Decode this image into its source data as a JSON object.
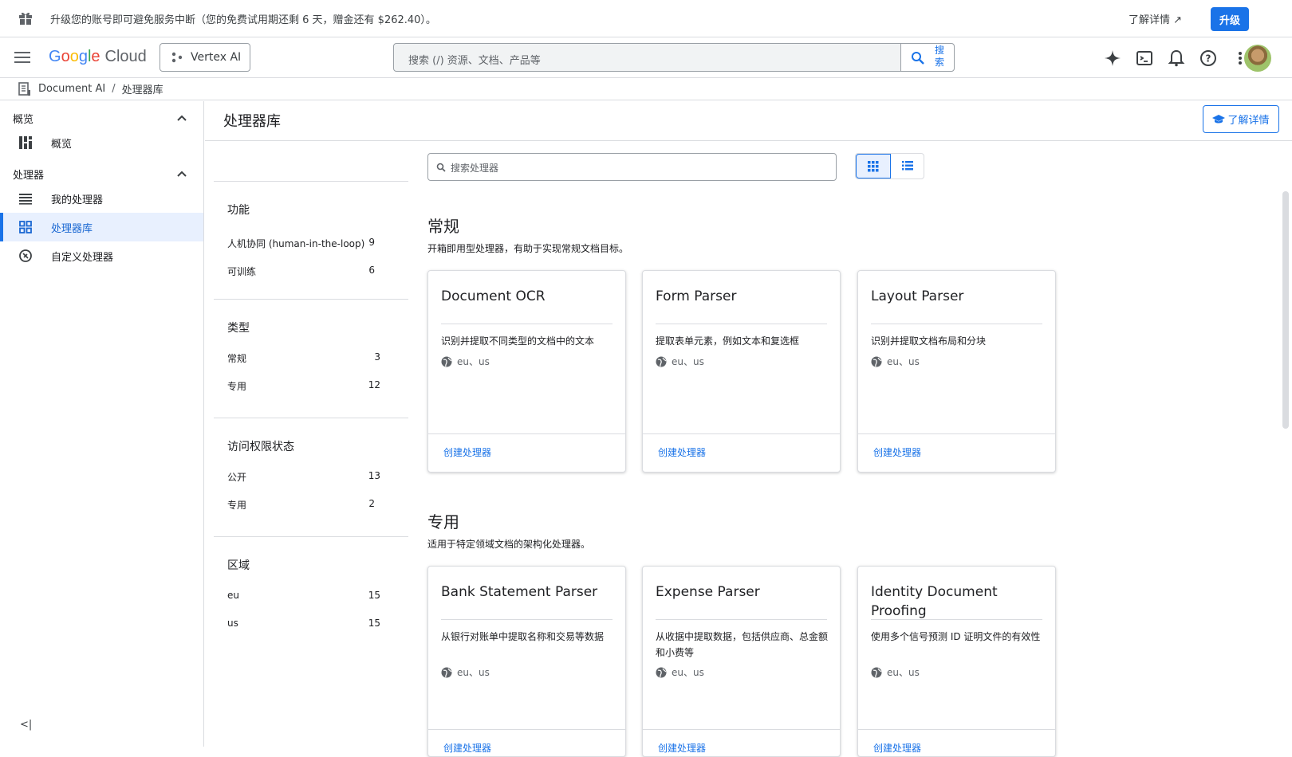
{
  "banner": {
    "message": "升级您的账号即可避免服务中断（您的免费试用期还剩 6 天，赠金还有 $262.40）。",
    "learn_more": "了解详情",
    "upgrade": "升级"
  },
  "header": {
    "logo_letters": [
      "G",
      "o",
      "o",
      "g",
      "l",
      "e"
    ],
    "logo_suffix": "Cloud",
    "product": "Vertex AI",
    "search_placeholder": "搜索 (/) 资源、文档、产品等",
    "search_button": "搜索"
  },
  "breadcrumb": {
    "root": "Document AI",
    "separator": "/",
    "current": "处理器库"
  },
  "sidebar": {
    "sections": [
      {
        "label": "概览",
        "items": [
          {
            "label": "概览",
            "icon": "dashboard-icon"
          }
        ]
      },
      {
        "label": "处理器",
        "items": [
          {
            "label": "我的处理器",
            "icon": "list-icon"
          },
          {
            "label": "处理器库",
            "icon": "grid-icon",
            "active": true
          },
          {
            "label": "自定义处理器",
            "icon": "custom-icon"
          }
        ]
      }
    ],
    "collapse": "<|"
  },
  "main": {
    "title": "处理器库",
    "learn_more": "了解详情",
    "search_placeholder": "搜索处理器"
  },
  "filters": [
    {
      "heading": "功能",
      "rows": [
        {
          "label": "人机协同 (human-in-the-loop)",
          "count": "9"
        },
        {
          "label": "可训练",
          "count": "6"
        }
      ]
    },
    {
      "heading": "类型",
      "rows": [
        {
          "label": "常规",
          "count": "3"
        },
        {
          "label": "专用",
          "count": "12"
        }
      ]
    },
    {
      "heading": "访问权限状态",
      "rows": [
        {
          "label": "公开",
          "count": "13"
        },
        {
          "label": "专用",
          "count": "2"
        }
      ]
    },
    {
      "heading": "区域",
      "rows": [
        {
          "label": "eu",
          "count": "15"
        },
        {
          "label": "us",
          "count": "15"
        }
      ]
    }
  ],
  "sections": [
    {
      "title": "常规",
      "desc": "开箱即用型处理器，有助于实现常规文档目标。",
      "cards": [
        {
          "title": "Document OCR",
          "desc": "识别并提取不同类型的文档中的文本",
          "regions": "eu、us",
          "action": "创建处理器"
        },
        {
          "title": "Form Parser",
          "desc": "提取表单元素，例如文本和复选框",
          "regions": "eu、us",
          "action": "创建处理器"
        },
        {
          "title": "Layout Parser",
          "desc": "识别并提取文档布局和分块",
          "regions": "eu、us",
          "action": "创建处理器"
        }
      ]
    },
    {
      "title": "专用",
      "desc": "适用于特定领域文档的架构化处理器。",
      "cards": [
        {
          "title": "Bank Statement Parser",
          "desc": "从银行对账单中提取名称和交易等数据",
          "regions": "eu、us",
          "action": "创建处理器"
        },
        {
          "title": "Expense Parser",
          "desc": "从收据中提取数据，包括供应商、总金额和小费等",
          "regions": "eu、us",
          "action": "创建处理器"
        },
        {
          "title": "Identity Document Proofing",
          "desc": "使用多个信号预测 ID 证明文件的有效性",
          "regions": "eu、us",
          "action": "创建处理器"
        }
      ]
    }
  ],
  "colors": {
    "accent": "#1a73e8",
    "active_bg": "#e8f0fe",
    "border": "#dadce0"
  }
}
